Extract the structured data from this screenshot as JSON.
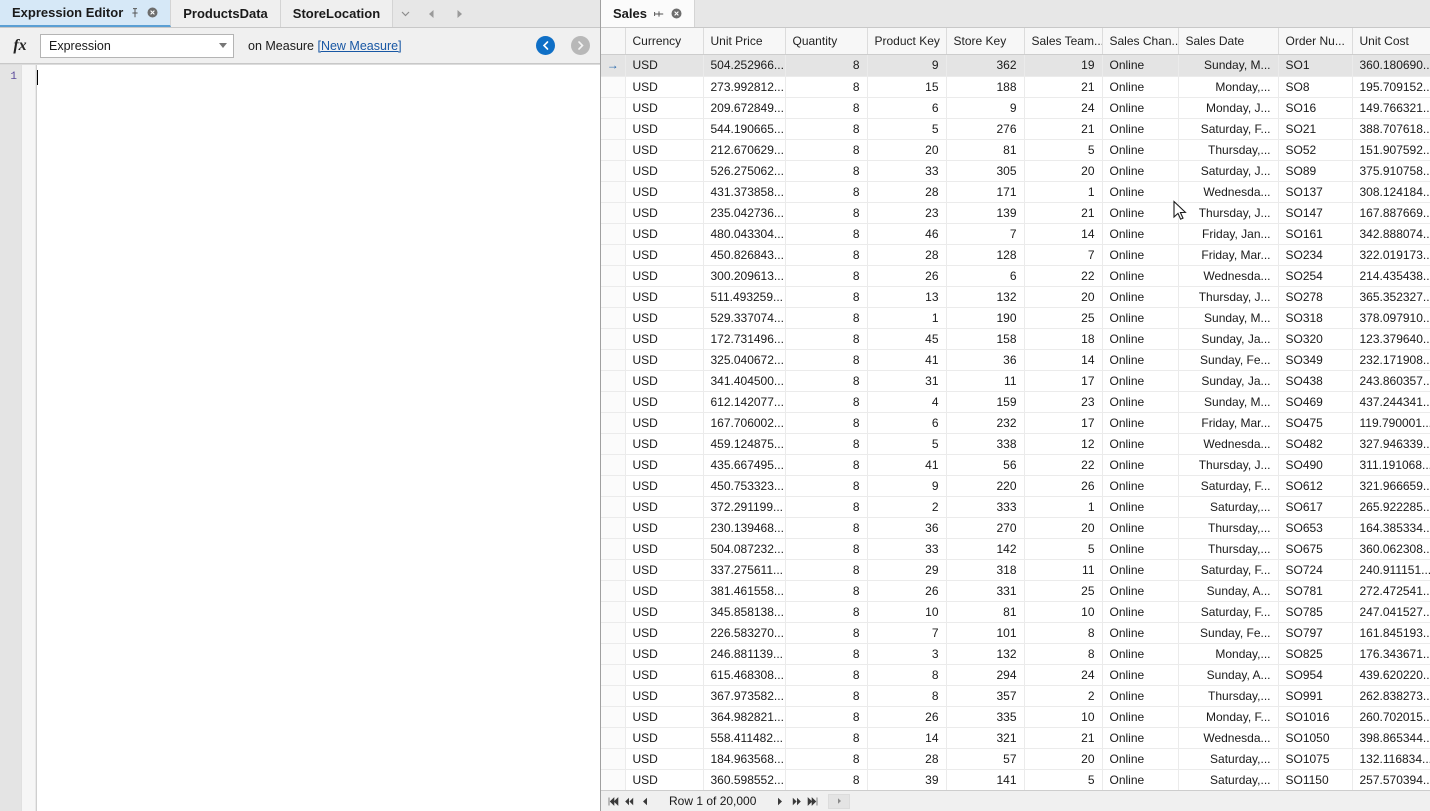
{
  "left_panel": {
    "tabs": [
      {
        "label": "Expression Editor",
        "active": true,
        "pin_icon": "pin-icon",
        "close_icon": "close-icon"
      },
      {
        "label": "ProductsData",
        "active": false
      },
      {
        "label": "StoreLocation",
        "active": false
      }
    ],
    "tab_nav": {
      "dropdown_icon": "chevron-down-icon",
      "prev_icon": "chevron-left-icon",
      "next_icon": "chevron-right-icon"
    },
    "expression_bar": {
      "fx_icon": "fx-icon",
      "combo_value": "Expression",
      "combo_caret_icon": "chevron-down-icon",
      "context_prefix": "on Measure ",
      "context_link": "[New Measure]",
      "back_icon": "back-arrow-icon",
      "forward_icon": "forward-arrow-icon"
    },
    "editor": {
      "line_numbers": [
        "1"
      ],
      "content": ""
    }
  },
  "right_panel": {
    "tabs": [
      {
        "label": "Sales",
        "active": true,
        "pin_icon": "pin-icon",
        "close_icon": "close-icon"
      }
    ],
    "grid": {
      "columns": [
        {
          "key": "currency",
          "label": "Currency",
          "width": 78,
          "align": "left"
        },
        {
          "key": "unit_price",
          "label": "Unit Price",
          "width": 82,
          "align": "right"
        },
        {
          "key": "quantity",
          "label": "Quantity",
          "width": 82,
          "align": "right"
        },
        {
          "key": "product_key",
          "label": "Product Key",
          "width": 79,
          "align": "right"
        },
        {
          "key": "store_key",
          "label": "Store Key",
          "width": 78,
          "align": "right"
        },
        {
          "key": "sales_team",
          "label": "Sales Team...",
          "width": 78,
          "align": "right"
        },
        {
          "key": "sales_channel",
          "label": "Sales Chan...",
          "width": 76,
          "align": "left"
        },
        {
          "key": "sales_date",
          "label": "Sales Date",
          "width": 100,
          "align": "right"
        },
        {
          "key": "order_number",
          "label": "Order Nu...",
          "width": 74,
          "align": "left"
        },
        {
          "key": "unit_cost",
          "label": "Unit Cost",
          "width": 98,
          "align": "left"
        }
      ],
      "rows": [
        {
          "selected": true,
          "currency": "USD",
          "unit_price": "504.252966...",
          "quantity": "8",
          "product_key": "9",
          "store_key": "362",
          "sales_team": "19",
          "sales_channel": "Online",
          "sales_date": "Sunday, M...",
          "order_number": "SO1",
          "unit_cost": "360.180690..."
        },
        {
          "selected": false,
          "currency": "USD",
          "unit_price": "273.992812...",
          "quantity": "8",
          "product_key": "15",
          "store_key": "188",
          "sales_team": "21",
          "sales_channel": "Online",
          "sales_date": "Monday,...",
          "order_number": "SO8",
          "unit_cost": "195.709152..."
        },
        {
          "selected": false,
          "currency": "USD",
          "unit_price": "209.672849...",
          "quantity": "8",
          "product_key": "6",
          "store_key": "9",
          "sales_team": "24",
          "sales_channel": "Online",
          "sales_date": "Monday, J...",
          "order_number": "SO16",
          "unit_cost": "149.766321..."
        },
        {
          "selected": false,
          "currency": "USD",
          "unit_price": "544.190665...",
          "quantity": "8",
          "product_key": "5",
          "store_key": "276",
          "sales_team": "21",
          "sales_channel": "Online",
          "sales_date": "Saturday, F...",
          "order_number": "SO21",
          "unit_cost": "388.707618..."
        },
        {
          "selected": false,
          "currency": "USD",
          "unit_price": "212.670629...",
          "quantity": "8",
          "product_key": "20",
          "store_key": "81",
          "sales_team": "5",
          "sales_channel": "Online",
          "sales_date": "Thursday,...",
          "order_number": "SO52",
          "unit_cost": "151.907592..."
        },
        {
          "selected": false,
          "currency": "USD",
          "unit_price": "526.275062...",
          "quantity": "8",
          "product_key": "33",
          "store_key": "305",
          "sales_team": "20",
          "sales_channel": "Online",
          "sales_date": "Saturday, J...",
          "order_number": "SO89",
          "unit_cost": "375.910758..."
        },
        {
          "selected": false,
          "currency": "USD",
          "unit_price": "431.373858...",
          "quantity": "8",
          "product_key": "28",
          "store_key": "171",
          "sales_team": "1",
          "sales_channel": "Online",
          "sales_date": "Wednesda...",
          "order_number": "SO137",
          "unit_cost": "308.124184..."
        },
        {
          "selected": false,
          "currency": "USD",
          "unit_price": "235.042736...",
          "quantity": "8",
          "product_key": "23",
          "store_key": "139",
          "sales_team": "21",
          "sales_channel": "Online",
          "sales_date": "Thursday, J...",
          "order_number": "SO147",
          "unit_cost": "167.887669..."
        },
        {
          "selected": false,
          "currency": "USD",
          "unit_price": "480.043304...",
          "quantity": "8",
          "product_key": "46",
          "store_key": "7",
          "sales_team": "14",
          "sales_channel": "Online",
          "sales_date": "Friday, Jan...",
          "order_number": "SO161",
          "unit_cost": "342.888074..."
        },
        {
          "selected": false,
          "currency": "USD",
          "unit_price": "450.826843...",
          "quantity": "8",
          "product_key": "28",
          "store_key": "128",
          "sales_team": "7",
          "sales_channel": "Online",
          "sales_date": "Friday, Mar...",
          "order_number": "SO234",
          "unit_cost": "322.019173..."
        },
        {
          "selected": false,
          "currency": "USD",
          "unit_price": "300.209613...",
          "quantity": "8",
          "product_key": "26",
          "store_key": "6",
          "sales_team": "22",
          "sales_channel": "Online",
          "sales_date": "Wednesda...",
          "order_number": "SO254",
          "unit_cost": "214.435438..."
        },
        {
          "selected": false,
          "currency": "USD",
          "unit_price": "511.493259...",
          "quantity": "8",
          "product_key": "13",
          "store_key": "132",
          "sales_team": "20",
          "sales_channel": "Online",
          "sales_date": "Thursday, J...",
          "order_number": "SO278",
          "unit_cost": "365.352327..."
        },
        {
          "selected": false,
          "currency": "USD",
          "unit_price": "529.337074...",
          "quantity": "8",
          "product_key": "1",
          "store_key": "190",
          "sales_team": "25",
          "sales_channel": "Online",
          "sales_date": "Sunday, M...",
          "order_number": "SO318",
          "unit_cost": "378.097910..."
        },
        {
          "selected": false,
          "currency": "USD",
          "unit_price": "172.731496...",
          "quantity": "8",
          "product_key": "45",
          "store_key": "158",
          "sales_team": "18",
          "sales_channel": "Online",
          "sales_date": "Sunday, Ja...",
          "order_number": "SO320",
          "unit_cost": "123.379640..."
        },
        {
          "selected": false,
          "currency": "USD",
          "unit_price": "325.040672...",
          "quantity": "8",
          "product_key": "41",
          "store_key": "36",
          "sales_team": "14",
          "sales_channel": "Online",
          "sales_date": "Sunday, Fe...",
          "order_number": "SO349",
          "unit_cost": "232.171908..."
        },
        {
          "selected": false,
          "currency": "USD",
          "unit_price": "341.404500...",
          "quantity": "8",
          "product_key": "31",
          "store_key": "11",
          "sales_team": "17",
          "sales_channel": "Online",
          "sales_date": "Sunday, Ja...",
          "order_number": "SO438",
          "unit_cost": "243.860357..."
        },
        {
          "selected": false,
          "currency": "USD",
          "unit_price": "612.142077...",
          "quantity": "8",
          "product_key": "4",
          "store_key": "159",
          "sales_team": "23",
          "sales_channel": "Online",
          "sales_date": "Sunday, M...",
          "order_number": "SO469",
          "unit_cost": "437.244341..."
        },
        {
          "selected": false,
          "currency": "USD",
          "unit_price": "167.706002...",
          "quantity": "8",
          "product_key": "6",
          "store_key": "232",
          "sales_team": "17",
          "sales_channel": "Online",
          "sales_date": "Friday, Mar...",
          "order_number": "SO475",
          "unit_cost": "119.790001..."
        },
        {
          "selected": false,
          "currency": "USD",
          "unit_price": "459.124875...",
          "quantity": "8",
          "product_key": "5",
          "store_key": "338",
          "sales_team": "12",
          "sales_channel": "Online",
          "sales_date": "Wednesda...",
          "order_number": "SO482",
          "unit_cost": "327.946339..."
        },
        {
          "selected": false,
          "currency": "USD",
          "unit_price": "435.667495...",
          "quantity": "8",
          "product_key": "41",
          "store_key": "56",
          "sales_team": "22",
          "sales_channel": "Online",
          "sales_date": "Thursday, J...",
          "order_number": "SO490",
          "unit_cost": "311.191068..."
        },
        {
          "selected": false,
          "currency": "USD",
          "unit_price": "450.753323...",
          "quantity": "8",
          "product_key": "9",
          "store_key": "220",
          "sales_team": "26",
          "sales_channel": "Online",
          "sales_date": "Saturday, F...",
          "order_number": "SO612",
          "unit_cost": "321.966659..."
        },
        {
          "selected": false,
          "currency": "USD",
          "unit_price": "372.291199...",
          "quantity": "8",
          "product_key": "2",
          "store_key": "333",
          "sales_team": "1",
          "sales_channel": "Online",
          "sales_date": "Saturday,...",
          "order_number": "SO617",
          "unit_cost": "265.922285..."
        },
        {
          "selected": false,
          "currency": "USD",
          "unit_price": "230.139468...",
          "quantity": "8",
          "product_key": "36",
          "store_key": "270",
          "sales_team": "20",
          "sales_channel": "Online",
          "sales_date": "Thursday,...",
          "order_number": "SO653",
          "unit_cost": "164.385334..."
        },
        {
          "selected": false,
          "currency": "USD",
          "unit_price": "504.087232...",
          "quantity": "8",
          "product_key": "33",
          "store_key": "142",
          "sales_team": "5",
          "sales_channel": "Online",
          "sales_date": "Thursday,...",
          "order_number": "SO675",
          "unit_cost": "360.062308..."
        },
        {
          "selected": false,
          "currency": "USD",
          "unit_price": "337.275611...",
          "quantity": "8",
          "product_key": "29",
          "store_key": "318",
          "sales_team": "11",
          "sales_channel": "Online",
          "sales_date": "Saturday, F...",
          "order_number": "SO724",
          "unit_cost": "240.911151..."
        },
        {
          "selected": false,
          "currency": "USD",
          "unit_price": "381.461558...",
          "quantity": "8",
          "product_key": "26",
          "store_key": "331",
          "sales_team": "25",
          "sales_channel": "Online",
          "sales_date": "Sunday, A...",
          "order_number": "SO781",
          "unit_cost": "272.472541..."
        },
        {
          "selected": false,
          "currency": "USD",
          "unit_price": "345.858138...",
          "quantity": "8",
          "product_key": "10",
          "store_key": "81",
          "sales_team": "10",
          "sales_channel": "Online",
          "sales_date": "Saturday, F...",
          "order_number": "SO785",
          "unit_cost": "247.041527..."
        },
        {
          "selected": false,
          "currency": "USD",
          "unit_price": "226.583270...",
          "quantity": "8",
          "product_key": "7",
          "store_key": "101",
          "sales_team": "8",
          "sales_channel": "Online",
          "sales_date": "Sunday, Fe...",
          "order_number": "SO797",
          "unit_cost": "161.845193..."
        },
        {
          "selected": false,
          "currency": "USD",
          "unit_price": "246.881139...",
          "quantity": "8",
          "product_key": "3",
          "store_key": "132",
          "sales_team": "8",
          "sales_channel": "Online",
          "sales_date": "Monday,...",
          "order_number": "SO825",
          "unit_cost": "176.343671..."
        },
        {
          "selected": false,
          "currency": "USD",
          "unit_price": "615.468308...",
          "quantity": "8",
          "product_key": "8",
          "store_key": "294",
          "sales_team": "24",
          "sales_channel": "Online",
          "sales_date": "Sunday, A...",
          "order_number": "SO954",
          "unit_cost": "439.620220..."
        },
        {
          "selected": false,
          "currency": "USD",
          "unit_price": "367.973582...",
          "quantity": "8",
          "product_key": "8",
          "store_key": "357",
          "sales_team": "2",
          "sales_channel": "Online",
          "sales_date": "Thursday,...",
          "order_number": "SO991",
          "unit_cost": "262.838273..."
        },
        {
          "selected": false,
          "currency": "USD",
          "unit_price": "364.982821...",
          "quantity": "8",
          "product_key": "26",
          "store_key": "335",
          "sales_team": "10",
          "sales_channel": "Online",
          "sales_date": "Monday, F...",
          "order_number": "SO1016",
          "unit_cost": "260.702015..."
        },
        {
          "selected": false,
          "currency": "USD",
          "unit_price": "558.411482...",
          "quantity": "8",
          "product_key": "14",
          "store_key": "321",
          "sales_team": "21",
          "sales_channel": "Online",
          "sales_date": "Wednesda...",
          "order_number": "SO1050",
          "unit_cost": "398.865344..."
        },
        {
          "selected": false,
          "currency": "USD",
          "unit_price": "184.963568...",
          "quantity": "8",
          "product_key": "28",
          "store_key": "57",
          "sales_team": "20",
          "sales_channel": "Online",
          "sales_date": "Saturday,...",
          "order_number": "SO1075",
          "unit_cost": "132.116834..."
        },
        {
          "selected": false,
          "currency": "USD",
          "unit_price": "360.598552...",
          "quantity": "8",
          "product_key": "39",
          "store_key": "141",
          "sales_team": "5",
          "sales_channel": "Online",
          "sales_date": "Saturday,...",
          "order_number": "SO1150",
          "unit_cost": "257.570394..."
        }
      ]
    },
    "status_bar": {
      "first_icon": "go-first-icon",
      "prev_page_icon": "go-prev-page-icon",
      "prev_icon": "go-prev-icon",
      "row_label": "Row 1 of 20,000",
      "next_icon": "go-next-icon",
      "next_page_icon": "go-next-page-icon",
      "last_icon": "go-last-icon",
      "hscroll_icon": "scroll-left-icon"
    }
  },
  "colors": {
    "active_tab_bg": "#d6e8f7",
    "accent": "#0f6fc6",
    "link": "#1857a4",
    "selection": "#e4e4e4",
    "line_number": "#5b4a9b"
  }
}
